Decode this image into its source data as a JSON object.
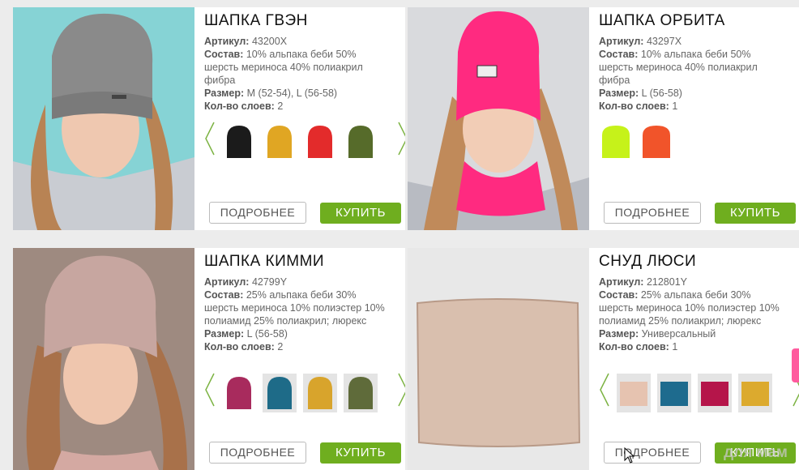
{
  "labels": {
    "article": "Артикул:",
    "composition": "Состав:",
    "size": "Размер:",
    "layers": "Кол-во слоев:"
  },
  "buttons": {
    "details": "ПОДРОБНЕЕ",
    "buy": "КУПИТЬ"
  },
  "products": [
    {
      "title": "ШАПКА ГВЭН",
      "article": "43200X",
      "composition": "10% альпака беби 50% шерсть мериноса 40% полиакрил фибра",
      "size": "M (52-54), L (56-58)",
      "layers": "2",
      "swatches": [
        {
          "color": "#1b1b1b"
        },
        {
          "color": "#e0a623"
        },
        {
          "color": "#e32b2b"
        },
        {
          "color": "#566b2a"
        }
      ]
    },
    {
      "title": "ШАПКА ОРБИТА",
      "article": "43297X",
      "composition": "10% альпака беби 50% шерсть мериноса 40% полиакрил фибра",
      "size": "L (56-58)",
      "layers": "1",
      "swatches": [
        {
          "color": "#c6f21a"
        },
        {
          "color": "#f1542a"
        }
      ]
    },
    {
      "title": "ШАПКА КИММИ",
      "article": "42799Y",
      "composition": "25% альпака беби 30% шерсть мериноса 10% полиэстер 10% полиамид 25% полиакрил; люрекс",
      "size": "L (56-58)",
      "layers": "2",
      "swatches": [
        {
          "color": "#a82b5d"
        },
        {
          "color": "#1e6b88"
        },
        {
          "color": "#d8a42c"
        },
        {
          "color": "#5f6b3a"
        }
      ]
    },
    {
      "title": "СНУД ЛЮСИ",
      "article": "212801Y",
      "composition": "25% альпака беби 30% шерсть мериноса 10% полиэстер 10% полиамид 25% полиакрил; люрекс",
      "size": "Универсальный",
      "layers": "1",
      "swatches": [
        {
          "color": "#e6c3b0"
        },
        {
          "color": "#1e6b8e"
        },
        {
          "color": "#b5154a"
        },
        {
          "color": "#dcaa2e"
        }
      ]
    }
  ],
  "watermark": "для мам",
  "colors": {
    "buy_button": "#6fae1f",
    "side_tab": "#ff5b9e"
  }
}
